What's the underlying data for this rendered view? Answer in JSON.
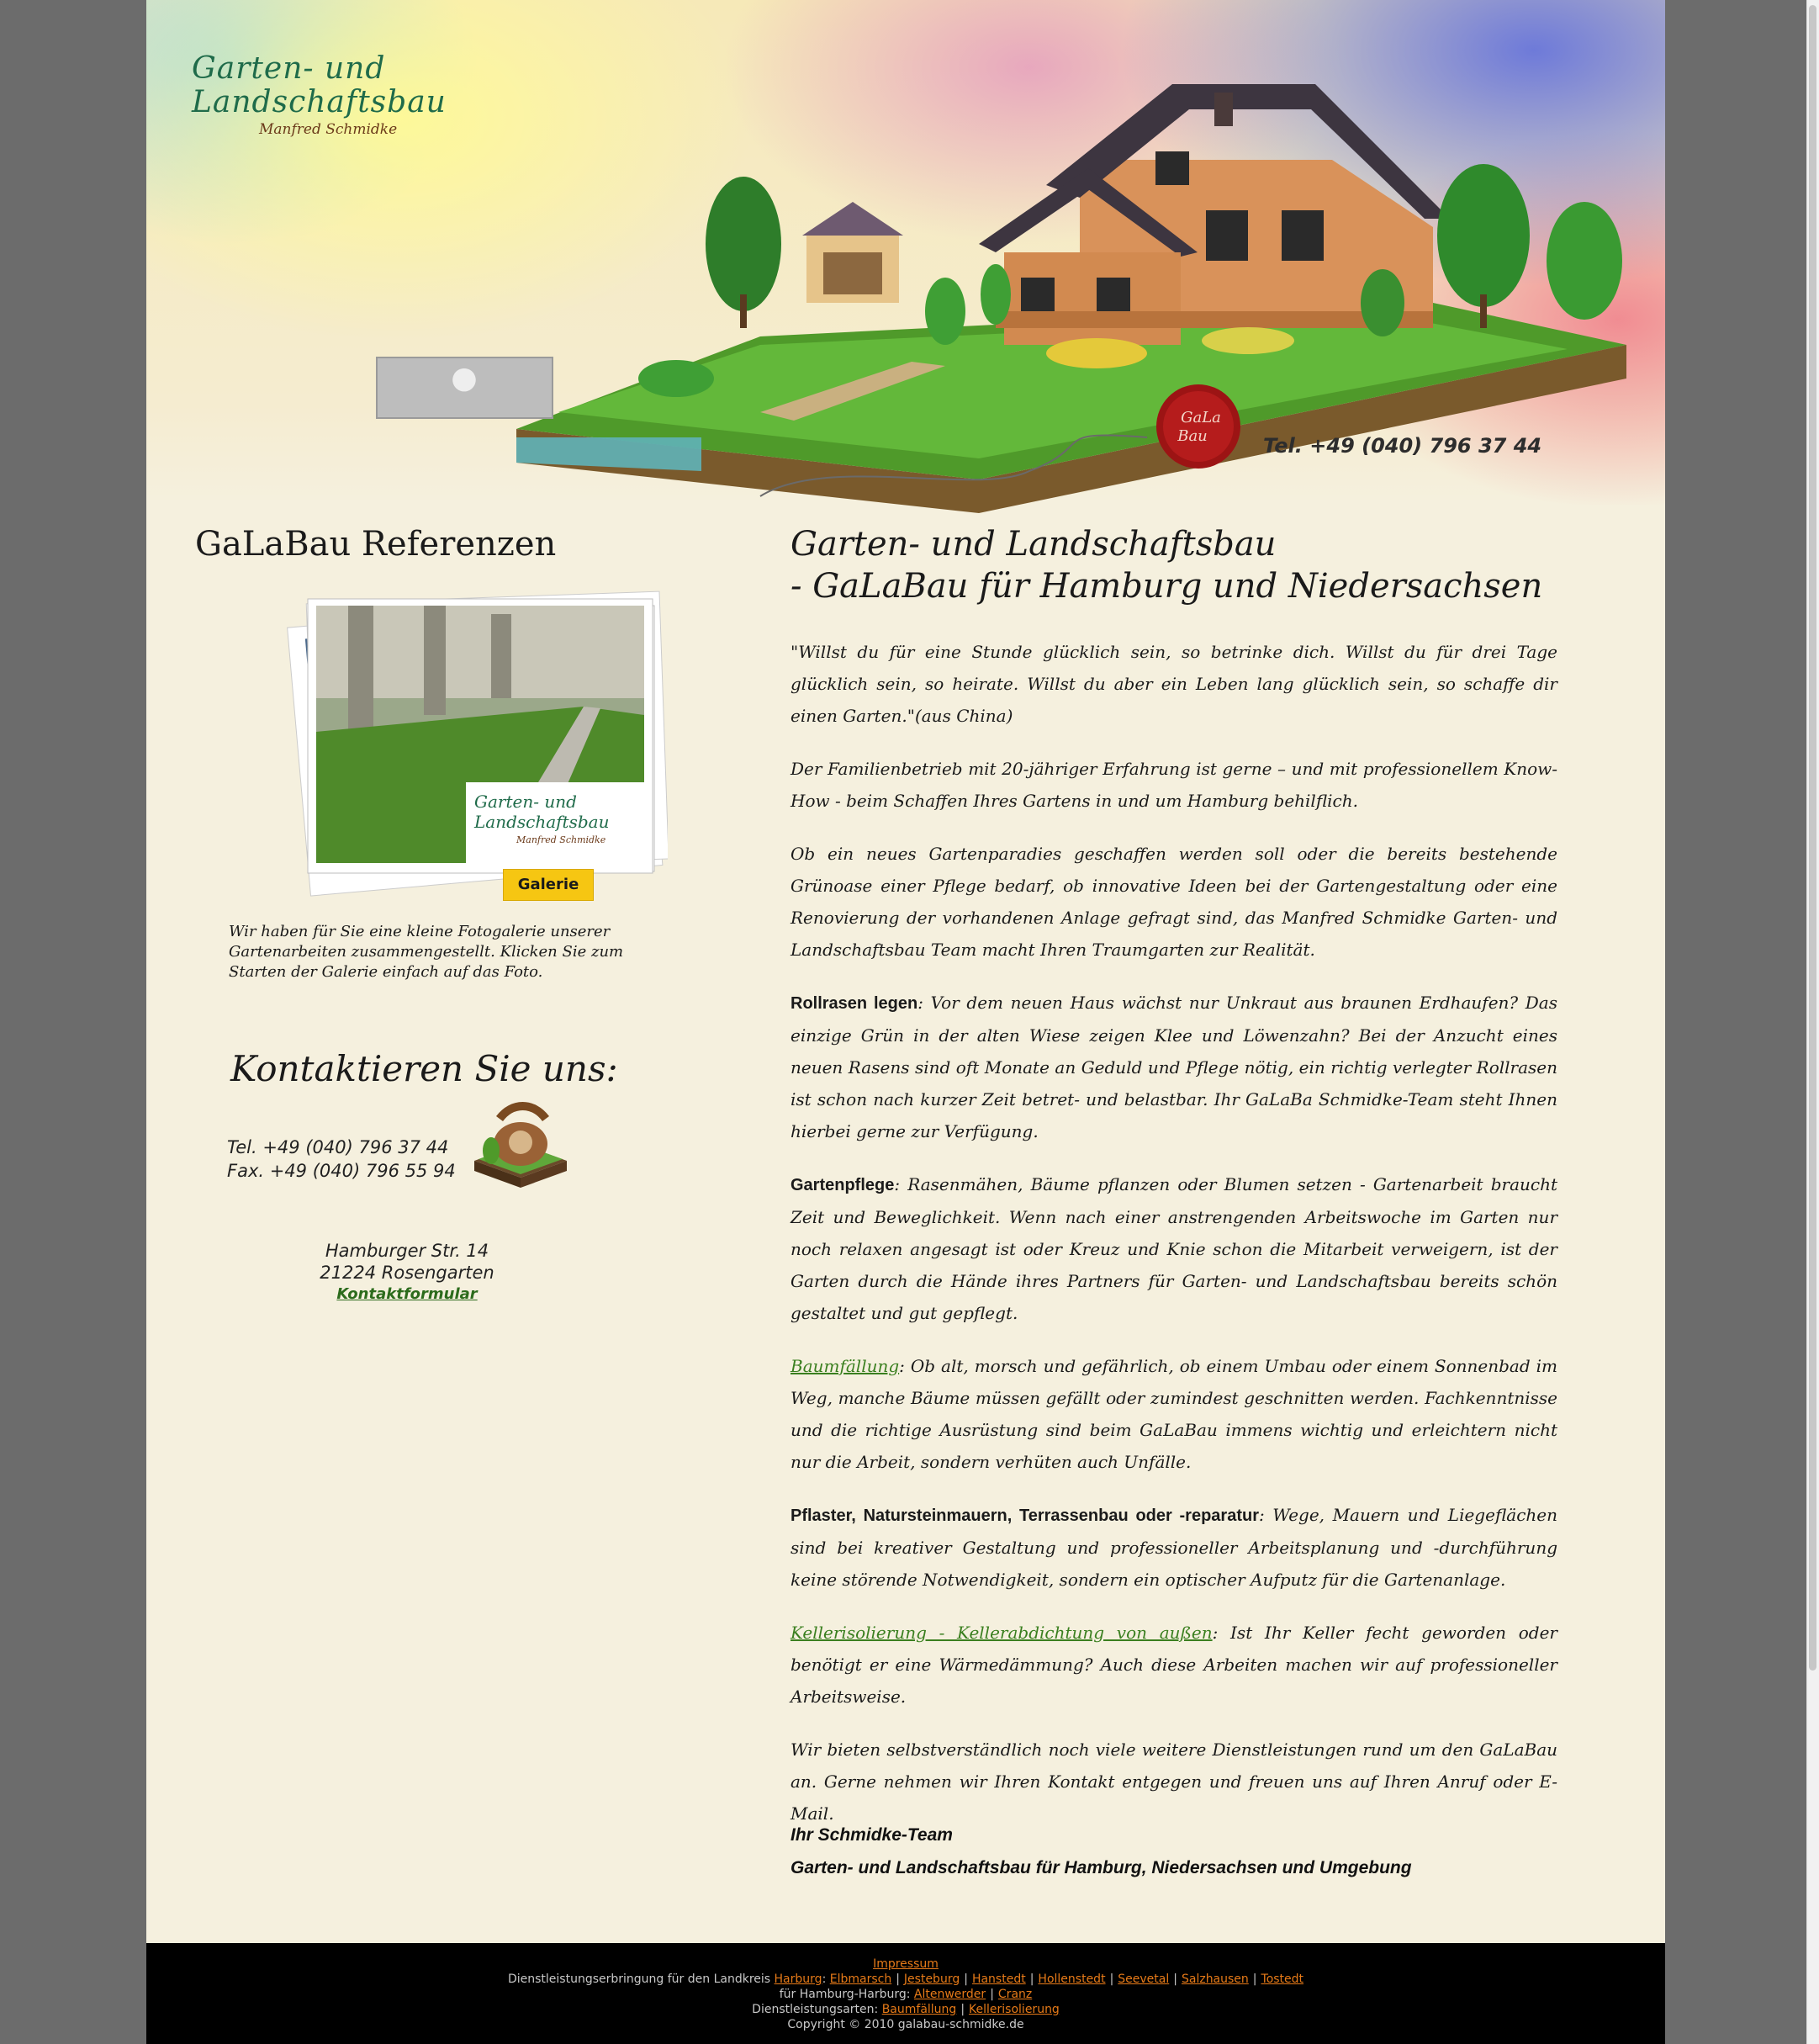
{
  "header": {
    "logo_line1": "Garten- und",
    "logo_line2": "Landschaftsbau",
    "logo_line3": "Manfred Schmidke",
    "seal_text1": "GaLa",
    "seal_text2": "Bau",
    "phone": "Tel. +49 (040) 796 37 44"
  },
  "sidebar": {
    "ref_title": "GaLaBau Referenzen",
    "gallery_logo_line1": "Garten- und",
    "gallery_logo_line2": "Landschaftsbau",
    "gallery_logo_line3": "Manfred Schmidke",
    "gallery_button": "Galerie",
    "gallery_desc": "Wir haben für Sie eine kleine Fotogalerie unserer Gartenarbeiten zusammengestellt. Klicken Sie zum Starten der Galerie einfach auf das Foto.",
    "contact_title": "Kontaktieren Sie uns:",
    "tel": "Tel. +49 (040) 796 37 44",
    "fax": "Fax. +49 (040) 796 55 94",
    "street": "Hamburger Str. 14",
    "city": "21224 Rosengarten",
    "contact_form": "Kontaktformular"
  },
  "main": {
    "title_line1": "Garten- und Landschaftsbau",
    "title_line2": "- GaLaBau für Hamburg und Niedersachsen",
    "quote": "\"Willst du für eine Stunde glücklich sein, so betrinke dich. Willst du für drei Tage glücklich sein, so heirate. Willst du aber ein Leben lang glücklich sein, so schaffe dir einen Garten.\"(aus China)",
    "para1": "Der Familienbetrieb mit 20-jähriger Erfahrung ist gerne – und mit professionellem Know-How - beim Schaffen Ihres Gartens in und um Hamburg behilflich.",
    "para2": "Ob ein neues Gartenparadies geschaffen werden soll oder die bereits bestehende Grünoase einer Pflege bedarf, ob innovative Ideen bei der Gartengestaltung oder eine Renovierung der vorhandenen Anlage gefragt sind, das Manfred Schmidke Garten- und Landschaftsbau Team macht Ihren Traumgarten zur Realität.",
    "rollrasen_label": "Rollrasen legen",
    "rollrasen_text": ": Vor dem neuen Haus wächst nur Unkraut aus braunen Erdhaufen? Das einzige Grün in der alten Wiese zeigen Klee und Löwenzahn? Bei der Anzucht eines neuen Rasens sind oft Monate an Geduld und Pflege nötig, ein richtig verlegter Rollrasen ist schon nach kurzer Zeit betret- und belastbar. Ihr GaLaBa Schmidke-Team steht Ihnen hierbei gerne zur Verfügung.",
    "gartenpflege_label": "Gartenpflege",
    "gartenpflege_text": ": Rasenmähen, Bäume pflanzen oder Blumen setzen - Gartenarbeit braucht Zeit und Beweglichkeit. Wenn nach einer anstrengenden Arbeitswoche im Garten nur noch relaxen angesagt ist oder Kreuz und Knie schon die Mitarbeit verweigern, ist der Garten durch die Hände ihres Partners für Garten- und Landschaftsbau bereits schön gestaltet und gut gepflegt.",
    "baumfaellung_label": "Baumfällung",
    "baumfaellung_text": ": Ob alt, morsch und gefährlich, ob einem Umbau oder einem Sonnenbad im Weg, manche Bäume müssen gefällt oder zumindest geschnitten werden. Fachkenntnisse und die richtige Ausrüstung sind beim GaLaBau immens wichtig und erleichtern nicht nur die Arbeit, sondern verhüten auch Unfälle.",
    "pflaster_label": "Pflaster, Natursteinmauern, Terrassenbau oder -reparatur",
    "pflaster_text": ": Wege, Mauern und Liegeflächen sind bei kreativer Gestaltung und professioneller Arbeitsplanung und -durchführung keine störende Notwendigkeit, sondern ein optischer Aufputz für die Gartenanlage.",
    "keller_label": "Kellerisolierung - Kellerabdichtung von außen",
    "keller_text": ": Ist Ihr Keller fecht geworden oder benötigt er eine Wärmedämmung? Auch diese Arbeiten machen wir auf professioneller Arbeitsweise.",
    "para_last": "Wir bieten selbstverständlich noch viele weitere Dienstleistungen rund um den GaLaBau an. Gerne nehmen wir Ihren Kontakt entgegen und freuen uns auf Ihren Anruf oder E-Mail.",
    "sign1": "Ihr Schmidke-Team",
    "sign2": "Garten- und Landschaftsbau für Hamburg, Niedersachsen und Umgebung"
  },
  "footer": {
    "impressum": "Impressum",
    "landkreis_prefix": "Dienstleistungserbringung für den Landkreis",
    "landkreis_links": [
      "Harburg",
      "Elbmarsch",
      "Jesteburg",
      "Hanstedt",
      "Hollenstedt",
      "Seevetal",
      "Salzhausen",
      "Tostedt"
    ],
    "hamburg_prefix": "für Hamburg-Harburg:",
    "hamburg_links": [
      "Altenwerder",
      "Cranz"
    ],
    "arten_prefix": "Dienstleistungsarten:",
    "arten_links": [
      "Baumfällung",
      "Kellerisolierung"
    ],
    "copyright": "Copyright © 2010 galabau-schmidke.de"
  }
}
